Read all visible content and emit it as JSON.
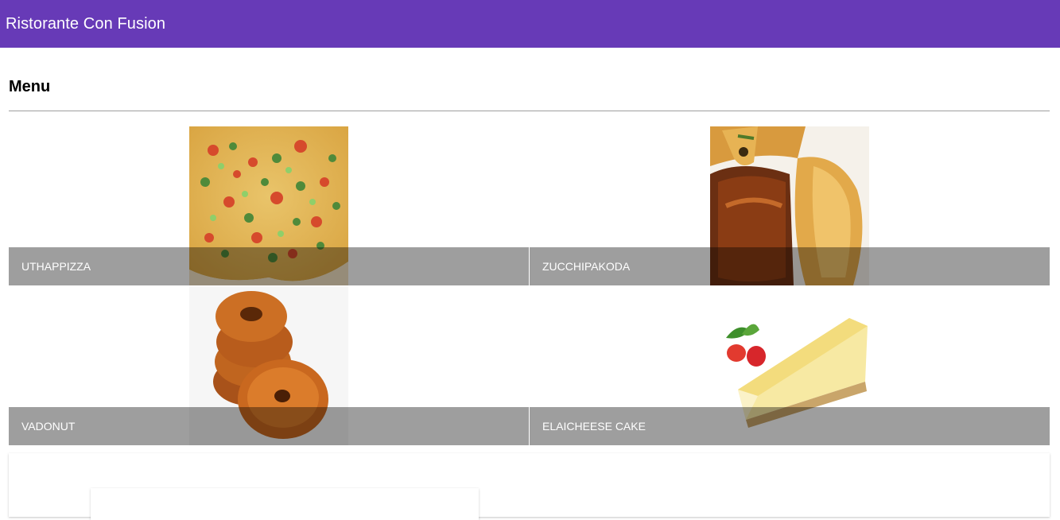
{
  "toolbar": {
    "title": "Ristorante Con Fusion"
  },
  "menu": {
    "heading": "Menu",
    "dishes": [
      {
        "name": "UthappizzA",
        "image_icon": "pizza-image"
      },
      {
        "name": "ZucchipakodA",
        "image_icon": "pakoda-image"
      },
      {
        "name": "VadonuT",
        "image_icon": "donut-image"
      },
      {
        "name": "ElaiCheese Cake",
        "image_icon": "cheesecake-image"
      }
    ]
  },
  "colors": {
    "primary": "#673ab7",
    "tile_footer": "rgba(0,0,0,0.38)",
    "divider": "#9e9e9e"
  }
}
